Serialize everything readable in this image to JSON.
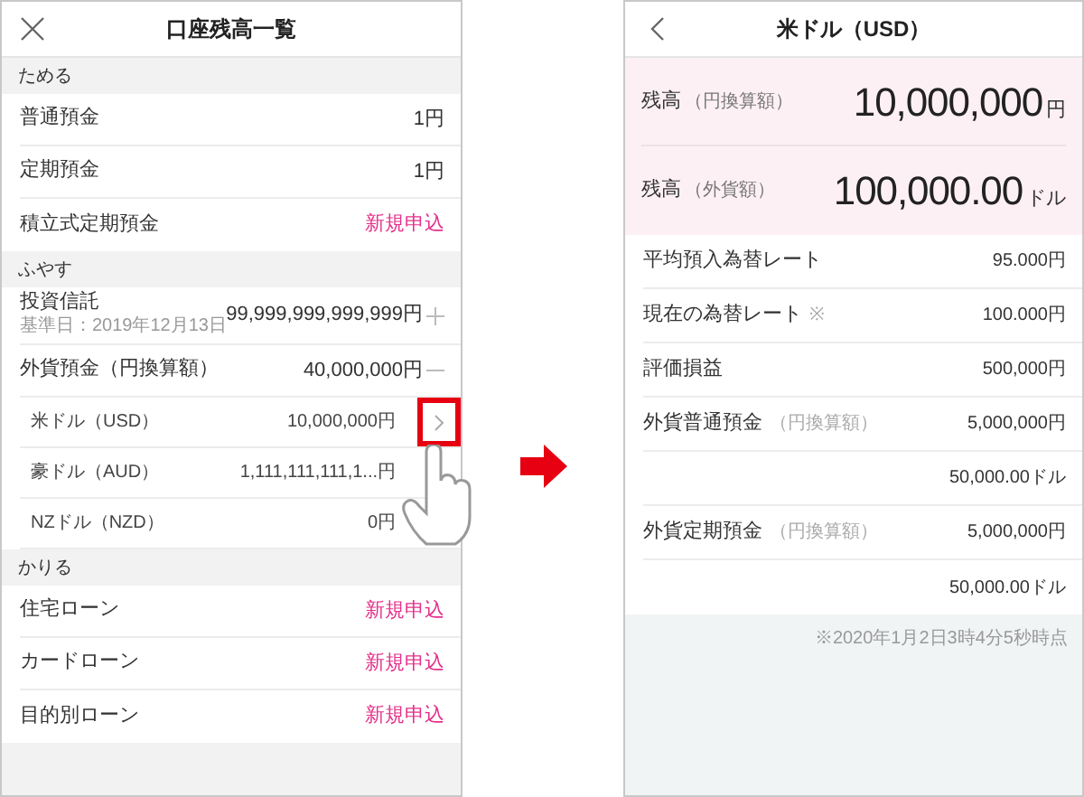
{
  "left_screen": {
    "title": "口座残高一覧",
    "sections": [
      {
        "label": "ためる",
        "items": [
          {
            "label": "普通預金",
            "kind": "amount",
            "value": "1円"
          },
          {
            "label": "定期預金",
            "kind": "amount",
            "value": "1円"
          },
          {
            "label": "積立式定期預金",
            "kind": "apply",
            "value": "新規申込"
          }
        ]
      },
      {
        "label": "ふやす",
        "items": [
          {
            "label": "投資信託",
            "sub": "基準日：2019年12月13日",
            "kind": "amount",
            "value": "99,999,999,999,999円",
            "expanded": false
          },
          {
            "label": "外貨預金（円換算額）",
            "kind": "amount",
            "value": "40,000,000円",
            "expanded": true,
            "children": [
              {
                "label": "米ドル（USD）",
                "value": "10,000,000円",
                "highlighted": true
              },
              {
                "label": "豪ドル（AUD）",
                "value": "1,111,111,111,1...円",
                "highlighted": false
              },
              {
                "label": "NZドル（NZD）",
                "value": "0円",
                "highlighted": false
              }
            ]
          }
        ]
      },
      {
        "label": "かりる",
        "items": [
          {
            "label": "住宅ローン",
            "kind": "apply",
            "value": "新規申込"
          },
          {
            "label": "カードローン",
            "kind": "apply",
            "value": "新規申込"
          },
          {
            "label": "目的別ローン",
            "kind": "apply",
            "value": "新規申込"
          }
        ]
      }
    ]
  },
  "right_screen": {
    "title": "米ドル（USD）",
    "balances": [
      {
        "label": "残高",
        "note": "（円換算額）",
        "amount": "10,000,000",
        "unit": "円"
      },
      {
        "label": "残高",
        "note": "（外貨額）",
        "amount": "100,000.00",
        "unit": "ドル"
      }
    ],
    "rows": [
      {
        "label": "平均預入為替レート",
        "value": "95.000円"
      },
      {
        "label": "現在の為替レート",
        "note": "※",
        "value": "100.000円"
      },
      {
        "label": "評価損益",
        "value": "500,000円"
      },
      {
        "label": "外貨普通預金",
        "note": "（円換算額）",
        "value": "5,000,000円"
      },
      {
        "value": "50,000.00ドル"
      },
      {
        "label": "外貨定期預金",
        "note": "（円換算額）",
        "value": "5,000,000円"
      },
      {
        "value": "50,000.00ドル"
      }
    ],
    "timestamp": "※2020年1月2日3時4分5秒時点"
  }
}
